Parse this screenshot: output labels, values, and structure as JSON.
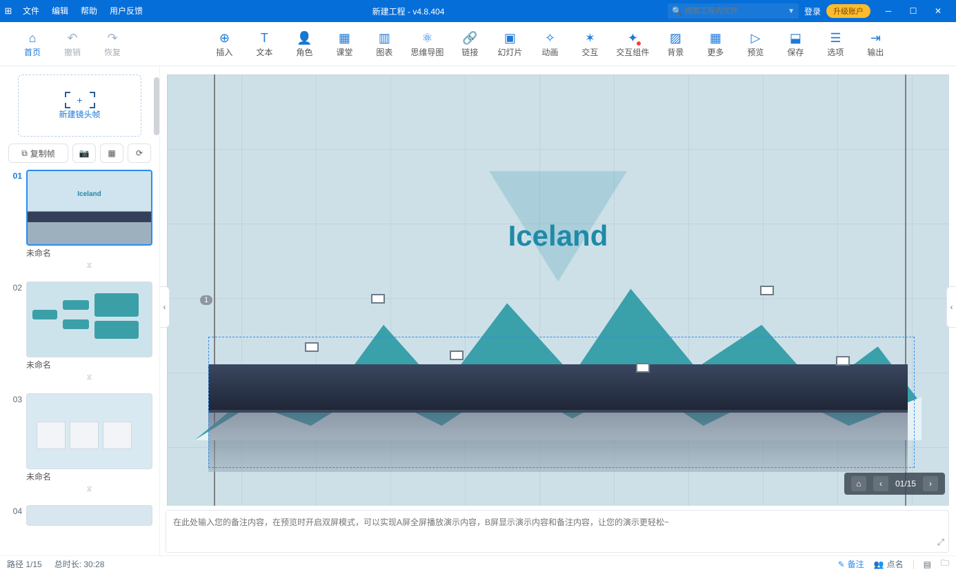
{
  "titlebar": {
    "menus": {
      "file": "文件",
      "edit": "编辑",
      "help": "帮助",
      "feedback": "用户反馈"
    },
    "center": "新建工程  -  v4.8.404",
    "search_placeholder": "搜索工程内文件",
    "login": "登录",
    "upgrade": "升级账户"
  },
  "toolbar": {
    "home": "首页",
    "undo": "撤销",
    "redo": "恢复",
    "insert": "插入",
    "text": "文本",
    "role": "角色",
    "class": "课堂",
    "chart": "图表",
    "mind": "思维导图",
    "link": "链接",
    "slide": "幻灯片",
    "anim": "动画",
    "interact": "交互",
    "interactc": "交互组件",
    "bg": "背景",
    "more": "更多",
    "preview": "预览",
    "save": "保存",
    "options": "选项",
    "output": "输出"
  },
  "sidebar": {
    "newframe": "新建镜头帧",
    "copy": "复制帧",
    "slides": [
      {
        "num": "01",
        "name": "未命名"
      },
      {
        "num": "02",
        "name": "未命名"
      },
      {
        "num": "03",
        "name": "未命名"
      },
      {
        "num": "04",
        "name": ""
      }
    ]
  },
  "canvas": {
    "title": "Iceland",
    "badge": "1",
    "nav": "01/15"
  },
  "notes": {
    "ph": "在此处输入您的备注内容，在预览时开启双屏模式，可以实现A屏全屏播放演示内容，B屏显示演示内容和备注内容，让您的演示更轻松~"
  },
  "status": {
    "path": "路径 1/15",
    "dur": "总时长: 30:28",
    "remark": "备注",
    "roll": "点名"
  }
}
